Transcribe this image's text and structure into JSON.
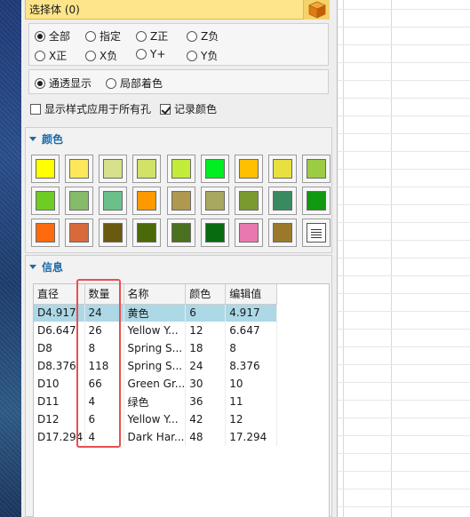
{
  "selection": {
    "title": "选择体 (0)",
    "cube_icon": "cube-icon"
  },
  "filter": {
    "options": [
      {
        "label": "全部",
        "checked": true
      },
      {
        "label": "指定",
        "checked": false
      },
      {
        "label": "Z正",
        "checked": false
      },
      {
        "label": "Z负",
        "checked": false
      },
      {
        "label": "X正",
        "checked": false
      },
      {
        "label": "X负",
        "checked": false
      },
      {
        "label": "Y+",
        "checked": false
      },
      {
        "label": "Y负",
        "checked": false
      }
    ]
  },
  "display": {
    "modes": [
      {
        "label": "通透显示",
        "checked": true
      },
      {
        "label": "局部着色",
        "checked": false
      }
    ],
    "apply_all": {
      "label": "显示样式应用于所有孔",
      "checked": false
    },
    "record_color": {
      "label": "记录颜色",
      "checked": true
    }
  },
  "colors": {
    "header": "颜色",
    "swatches": [
      "#ffff00",
      "#ffe75a",
      "#d7e08a",
      "#d2e268",
      "#c2ec3a",
      "#00ee22",
      "#ffc000",
      "#e8e040",
      "#9ccc44",
      "#6fcc22",
      "#86bb6a",
      "#6cbf8a",
      "#ff9900",
      "#b09850",
      "#a8a860",
      "#7a9a30",
      "#3a8a60",
      "#119911",
      "#ff6a10",
      "#d86a3a",
      "#6a5a10",
      "#4a6a0a",
      "#4a7020",
      "#0a6a10",
      "#e878b0",
      "#9a7a2a"
    ],
    "more_icon": "palette-list-icon"
  },
  "info": {
    "header": "信息",
    "columns": [
      "直径",
      "数量",
      "名称",
      "颜色",
      "编辑值"
    ],
    "rows": [
      [
        "D4.917",
        "24",
        "黄色",
        "6",
        "4.917"
      ],
      [
        "D6.647",
        "26",
        "Yellow Y...",
        "12",
        "6.647"
      ],
      [
        "D8",
        "8",
        "Spring S...",
        "18",
        "8"
      ],
      [
        "D8.376",
        "118",
        "Spring S...",
        "24",
        "8.376"
      ],
      [
        "D10",
        "66",
        "Green Gr...",
        "30",
        "10"
      ],
      [
        "D11",
        "4",
        "绿色",
        "36",
        "11"
      ],
      [
        "D12",
        "6",
        "Yellow Y...",
        "42",
        "12"
      ],
      [
        "D17.294",
        "4",
        "Dark Har...",
        "48",
        "17.294"
      ]
    ],
    "selected_row": 0
  }
}
